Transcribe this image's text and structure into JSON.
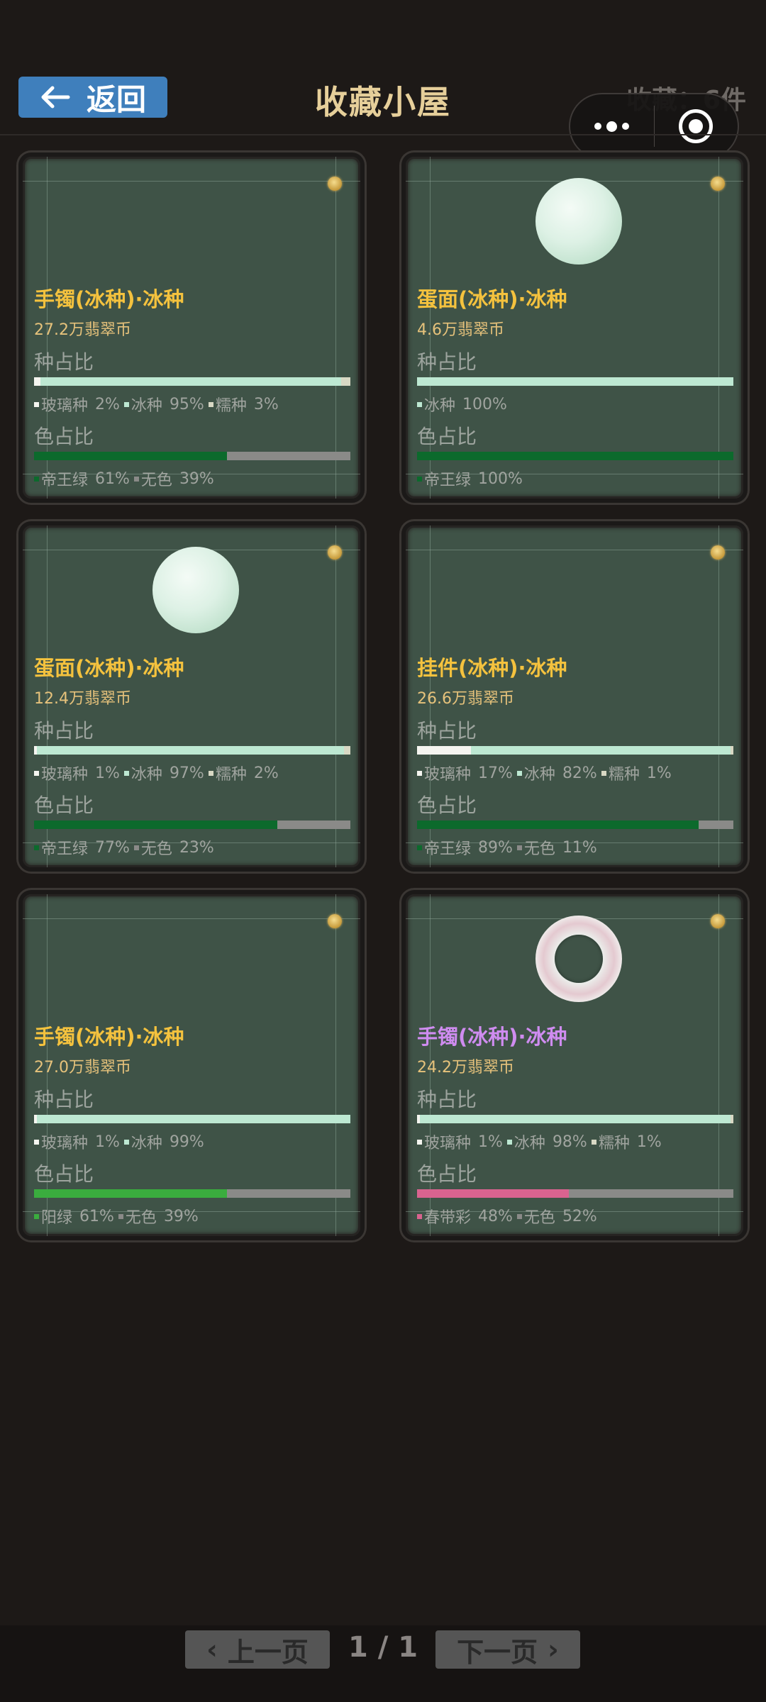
{
  "header": {
    "back_label": "返回",
    "title": "收藏小屋",
    "count_text": "收藏：6件"
  },
  "colors": {
    "background": "#1d1917",
    "card": "#3f5347",
    "title": "#e6cf9a",
    "back_button": "#3f7fbc",
    "gold_name": "#f4c23e",
    "purple_name": "#cf8cf0"
  },
  "cards": [
    {
      "name": "手镯(冰种)·冰种",
      "name_color": "#f4c23e",
      "price": "27.2万翡翠币",
      "icon": "none",
      "species_label": "种占比",
      "species": [
        {
          "name": "玻璃种",
          "value": "2%",
          "ratio": 0.02,
          "color": "#f5f5f0"
        },
        {
          "name": "冰种",
          "value": "95%",
          "ratio": 0.95,
          "color": "#bde8d2"
        },
        {
          "name": "糯种",
          "value": "3%",
          "ratio": 0.03,
          "color": "#d8d8c4"
        }
      ],
      "color_label": "色占比",
      "colors": [
        {
          "name": "帝王绿",
          "value": "61%",
          "ratio": 0.61,
          "color": "#0c6a2c"
        },
        {
          "name": "无色",
          "value": "39%",
          "ratio": 0.39,
          "color": "#8a8a88"
        }
      ]
    },
    {
      "name": "蛋面(冰种)·冰种",
      "name_color": "#f4c23e",
      "price": "4.6万翡翠币",
      "icon": "jade-cabochon",
      "species_label": "种占比",
      "species": [
        {
          "name": "冰种",
          "value": "100%",
          "ratio": 1.0,
          "color": "#bde8d2"
        }
      ],
      "color_label": "色占比",
      "colors": [
        {
          "name": "帝王绿",
          "value": "100%",
          "ratio": 1.0,
          "color": "#0c6a2c"
        }
      ]
    },
    {
      "name": "蛋面(冰种)·冰种",
      "name_color": "#f4c23e",
      "price": "12.4万翡翠币",
      "icon": "jade-cabochon",
      "species_label": "种占比",
      "species": [
        {
          "name": "玻璃种",
          "value": "1%",
          "ratio": 0.01,
          "color": "#f5f5f0"
        },
        {
          "name": "冰种",
          "value": "97%",
          "ratio": 0.97,
          "color": "#bde8d2"
        },
        {
          "name": "糯种",
          "value": "2%",
          "ratio": 0.02,
          "color": "#d8d8c4"
        }
      ],
      "color_label": "色占比",
      "colors": [
        {
          "name": "帝王绿",
          "value": "77%",
          "ratio": 0.77,
          "color": "#0c6a2c"
        },
        {
          "name": "无色",
          "value": "23%",
          "ratio": 0.23,
          "color": "#8a8a88"
        }
      ]
    },
    {
      "name": "挂件(冰种)·冰种",
      "name_color": "#f4c23e",
      "price": "26.6万翡翠币",
      "icon": "none",
      "species_label": "种占比",
      "species": [
        {
          "name": "玻璃种",
          "value": "17%",
          "ratio": 0.17,
          "color": "#f5f5f0"
        },
        {
          "name": "冰种",
          "value": "82%",
          "ratio": 0.82,
          "color": "#bde8d2"
        },
        {
          "name": "糯种",
          "value": "1%",
          "ratio": 0.01,
          "color": "#d8d8c4"
        }
      ],
      "color_label": "色占比",
      "colors": [
        {
          "name": "帝王绿",
          "value": "89%",
          "ratio": 0.89,
          "color": "#0c6a2c"
        },
        {
          "name": "无色",
          "value": "11%",
          "ratio": 0.11,
          "color": "#8a8a88"
        }
      ]
    },
    {
      "name": "手镯(冰种)·冰种",
      "name_color": "#f4c23e",
      "price": "27.0万翡翠币",
      "icon": "none",
      "species_label": "种占比",
      "species": [
        {
          "name": "玻璃种",
          "value": "1%",
          "ratio": 0.01,
          "color": "#f5f5f0"
        },
        {
          "name": "冰种",
          "value": "99%",
          "ratio": 0.99,
          "color": "#bde8d2"
        }
      ],
      "color_label": "色占比",
      "colors": [
        {
          "name": "阳绿",
          "value": "61%",
          "ratio": 0.61,
          "color": "#3aad3e"
        },
        {
          "name": "无色",
          "value": "39%",
          "ratio": 0.39,
          "color": "#8a8a88"
        }
      ]
    },
    {
      "name": "手镯(冰种)·冰种",
      "name_color": "#cf8cf0",
      "price": "24.2万翡翠币",
      "icon": "jade-bangle",
      "species_label": "种占比",
      "species": [
        {
          "name": "玻璃种",
          "value": "1%",
          "ratio": 0.01,
          "color": "#f5f5f0"
        },
        {
          "name": "冰种",
          "value": "98%",
          "ratio": 0.98,
          "color": "#bde8d2"
        },
        {
          "name": "糯种",
          "value": "1%",
          "ratio": 0.01,
          "color": "#d8d8c4"
        }
      ],
      "color_label": "色占比",
      "colors": [
        {
          "name": "春带彩",
          "value": "48%",
          "ratio": 0.48,
          "color": "#d9638f"
        },
        {
          "name": "无色",
          "value": "52%",
          "ratio": 0.52,
          "color": "#8a8a88"
        }
      ]
    }
  ],
  "pagination": {
    "prev_label": "上一页",
    "next_label": "下一页",
    "indicator": "1 / 1"
  }
}
